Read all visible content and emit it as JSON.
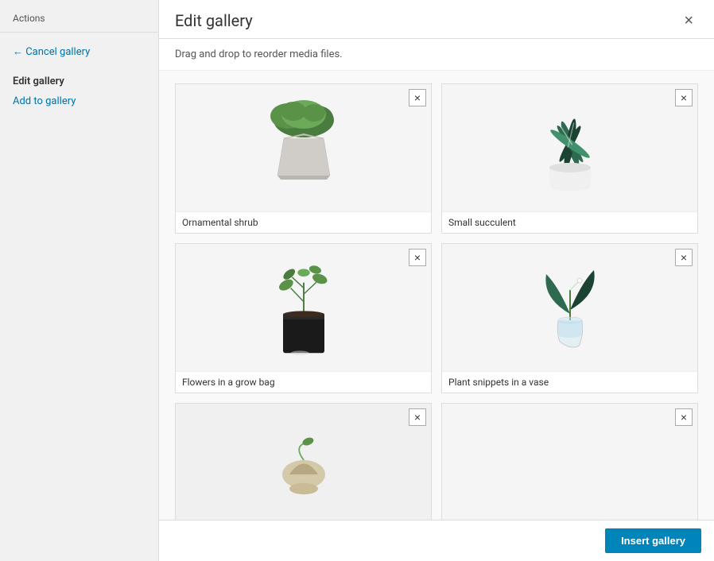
{
  "sidebar": {
    "actions_label": "Actions",
    "cancel_link": "← Cancel gallery",
    "section_title": "Edit gallery",
    "add_link": "Add to gallery"
  },
  "modal": {
    "title": "Edit gallery",
    "close_label": "×",
    "drag_hint": "Drag and drop to reorder media files.",
    "insert_button_label": "Insert gallery"
  },
  "gallery": {
    "items": [
      {
        "id": "item-1",
        "caption": "Ornamental shrub",
        "plant_type": "ornamental",
        "remove_label": "×"
      },
      {
        "id": "item-2",
        "caption": "Small succulent",
        "plant_type": "succulent",
        "remove_label": "×"
      },
      {
        "id": "item-3",
        "caption": "Flowers in a grow bag",
        "plant_type": "growbag",
        "remove_label": "×"
      },
      {
        "id": "item-4",
        "caption": "Plant snippets in a vase",
        "plant_type": "vase",
        "remove_label": "×"
      },
      {
        "id": "item-5",
        "caption": "",
        "plant_type": "partial1",
        "remove_label": "×"
      },
      {
        "id": "item-6",
        "caption": "",
        "plant_type": "partial2",
        "remove_label": "×"
      }
    ]
  }
}
